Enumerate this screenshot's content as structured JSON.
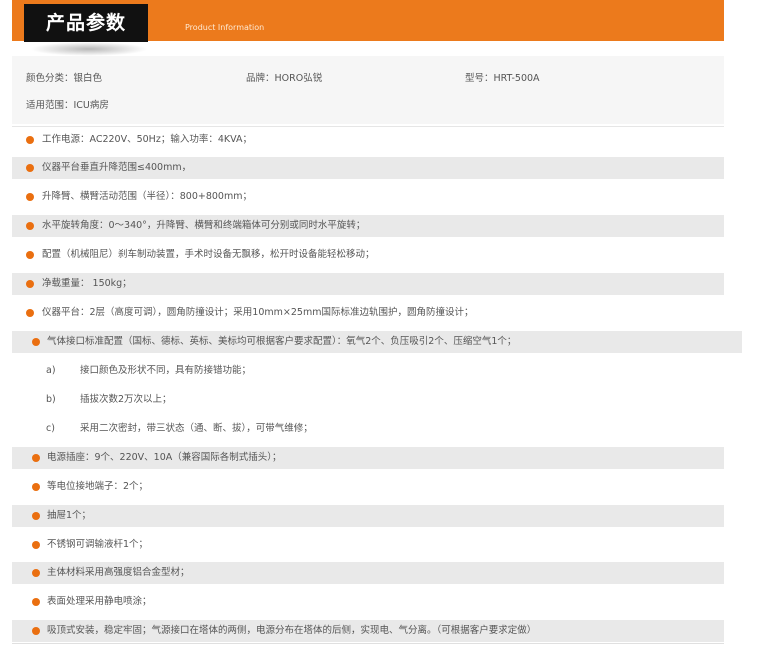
{
  "header": {
    "title": "产品参数",
    "subtitle": "Product Information"
  },
  "info": {
    "color": "颜色分类：银白色",
    "brand": "品牌：HORO弘锐",
    "model": "型号：HRT-500A",
    "scope": "适用范围：ICU病房"
  },
  "colors": {
    "accent": "#ec7a1c",
    "bullet": "#ea6f10",
    "row_shade": "#e9e9e9"
  },
  "specs": [
    "工作电源：AC220V、50Hz；输入功率：4KVA；",
    "仪器平台垂直升降范围≤400mm，",
    "升降臂、横臂活动范围（半径）：800+800mm；",
    "水平旋转角度：0～340°，升降臂、横臂和终端箱体可分别或同时水平旋转；",
    "配置（机械阻尼）刹车制动装置，手术时设备无飘移，松开时设备能轻松移动；",
    "净载重量： 150kg；",
    "仪器平台：2层（高度可调），圆角防撞设计；采用10mm×25mm国际标准边轨围护，圆角防撞设计；",
    "气体接口标准配置（国标、德标、英标、美标均可根据客户要求配置）：氧气2个、负压吸引2个、压缩空气1个；"
  ],
  "sub_items": [
    {
      "mark": "a)",
      "text": "接口颜色及形状不同，具有防接错功能；"
    },
    {
      "mark": "b)",
      "text": "插拔次数2万次以上；"
    },
    {
      "mark": "c)",
      "text": "采用二次密封，带三状态（通、断、拔），可带气维修；"
    }
  ],
  "specs2": [
    "电源插座：9个、220V、10A（兼容国际各制式插头）；",
    "等电位接地端子：2个；",
    "抽屉1个；",
    "不锈钢可调输液杆1个；",
    "主体材料采用高强度铝合金型材；",
    "表面处理采用静电喷涂；",
    "吸顶式安装，稳定牢固；气源接口在塔体的两侧，电源分布在塔体的后侧，实现电、气分离。（可根据客户要求定做）"
  ]
}
